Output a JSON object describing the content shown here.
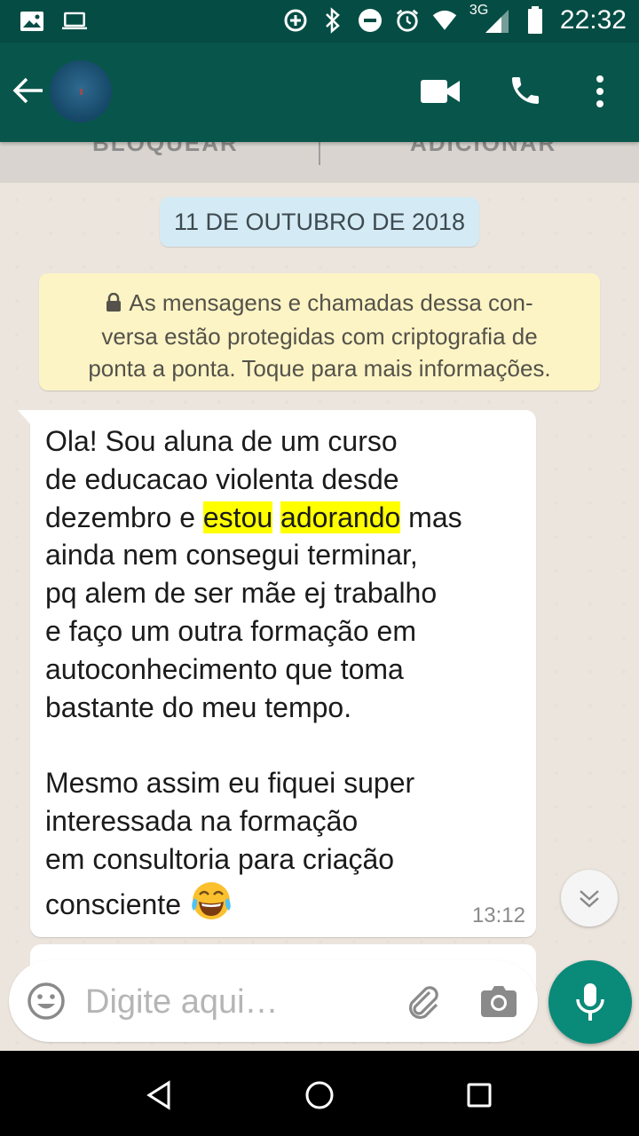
{
  "status_bar": {
    "time": "22:32",
    "network": "3G",
    "icons": [
      "image-icon",
      "laptop-icon",
      "data-saver-icon",
      "bluetooth-icon",
      "do-not-disturb-icon",
      "alarm-icon",
      "wifi-icon",
      "signal-icon",
      "battery-icon"
    ]
  },
  "app_bar": {
    "icons": [
      "back-arrow-icon",
      "video-call-icon",
      "phone-icon",
      "more-vert-icon"
    ]
  },
  "action_bar": {
    "block_label": "BLOQUEAR",
    "add_label": "ADICIONAR"
  },
  "chat": {
    "date_chip": "11 DE OUTUBRO DE 2018",
    "encryption_note": "As mensagens e chamadas dessa con-\nversa estão protegidas com criptografia de\nponta a ponta. Toque para mais informações.",
    "message": {
      "line1": "Ola! Sou aluna de um curso",
      "line2": "de educacao violenta desde",
      "line3_pre": "dezembro e ",
      "highlight1": "estou",
      "highlight2": "adorando",
      "line3_post": " mas",
      "rest": "ainda nem consegui terminar,\npq alem de ser mãe ej trabalho\ne faço um outra formação em\nautoconhecimento que toma\nbastante do meu tempo.\n\nMesmo assim eu fiquei super\ninteressada na formação\nem consultoria para criação",
      "last_line": "consciente",
      "emoji": "face-with-tears-of-joy",
      "time": "13:12"
    }
  },
  "input": {
    "placeholder": "Digite aqui…"
  },
  "colors": {
    "app_bar": "#08564b",
    "chat_bg": "#ece5dd",
    "highlight": "#ffff00",
    "mic_button": "#0a8a79"
  }
}
